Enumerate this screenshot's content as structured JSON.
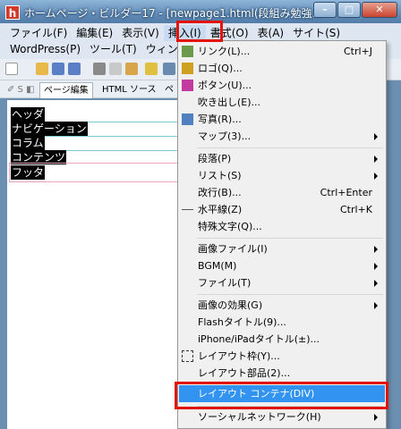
{
  "window": {
    "title": "ホームページ・ビルダー17 - [newpage1.html(段組み勉強...",
    "app_icon": "h",
    "buttons": {
      "minimize": "–",
      "maximize": "□",
      "close": "✕"
    }
  },
  "menubar": {
    "row1": [
      "ファイル(F)",
      "編集(E)",
      "表示(V)",
      "挿入(I)",
      "書式(O)",
      "表(A)",
      "サイト(S)"
    ],
    "row2": [
      "WordPress(P)",
      "ツール(T)",
      "ウィンドウ"
    ]
  },
  "tabs": {
    "items": [
      "ページ編集",
      "HTML ソース",
      "ペ"
    ]
  },
  "editor": {
    "blocks": [
      "ヘッダ",
      "ナビゲーション",
      "コラム",
      "コンテンツ",
      "フッタ"
    ]
  },
  "insert_menu": {
    "items": [
      {
        "label": "リンク(L)...",
        "shortcut": "Ctrl+J",
        "icon": "link-icon"
      },
      {
        "label": "ロゴ(Q)...",
        "icon": "logo-icon"
      },
      {
        "label": "ボタン(U)...",
        "icon": "button-icon"
      },
      {
        "label": "吹き出し(E)..."
      },
      {
        "label": "写真(R)...",
        "icon": "photo-icon"
      },
      {
        "label": "マップ(3)...",
        "submenu": true
      },
      {
        "label": "段落(P)",
        "submenu": true
      },
      {
        "label": "リスト(S)",
        "submenu": true
      },
      {
        "label": "改行(B)...",
        "shortcut": "Ctrl+Enter"
      },
      {
        "label": "水平線(Z)",
        "shortcut": "Ctrl+K",
        "icon": "hr-icon"
      },
      {
        "label": "特殊文字(Q)..."
      },
      {
        "label": "画像ファイル(I)",
        "submenu": true
      },
      {
        "label": "BGM(M)",
        "submenu": true
      },
      {
        "label": "ファイル(T)",
        "submenu": true
      },
      {
        "label": "画像の効果(G)",
        "submenu": true
      },
      {
        "label": "Flashタイトル(9)..."
      },
      {
        "label": "iPhone/iPadタイトル(±)..."
      },
      {
        "label": "レイアウト枠(Y)...",
        "icon": "layout-frame-icon"
      },
      {
        "label": "レイアウト部品(2)..."
      },
      {
        "label": "レイアウト コンテナ(DIV)",
        "highlighted": true
      },
      {
        "label": "ソーシャルネットワーク(H)",
        "submenu": true
      }
    ]
  },
  "colors": {
    "highlight": "#3294f0",
    "annotation": "#e3120b"
  }
}
